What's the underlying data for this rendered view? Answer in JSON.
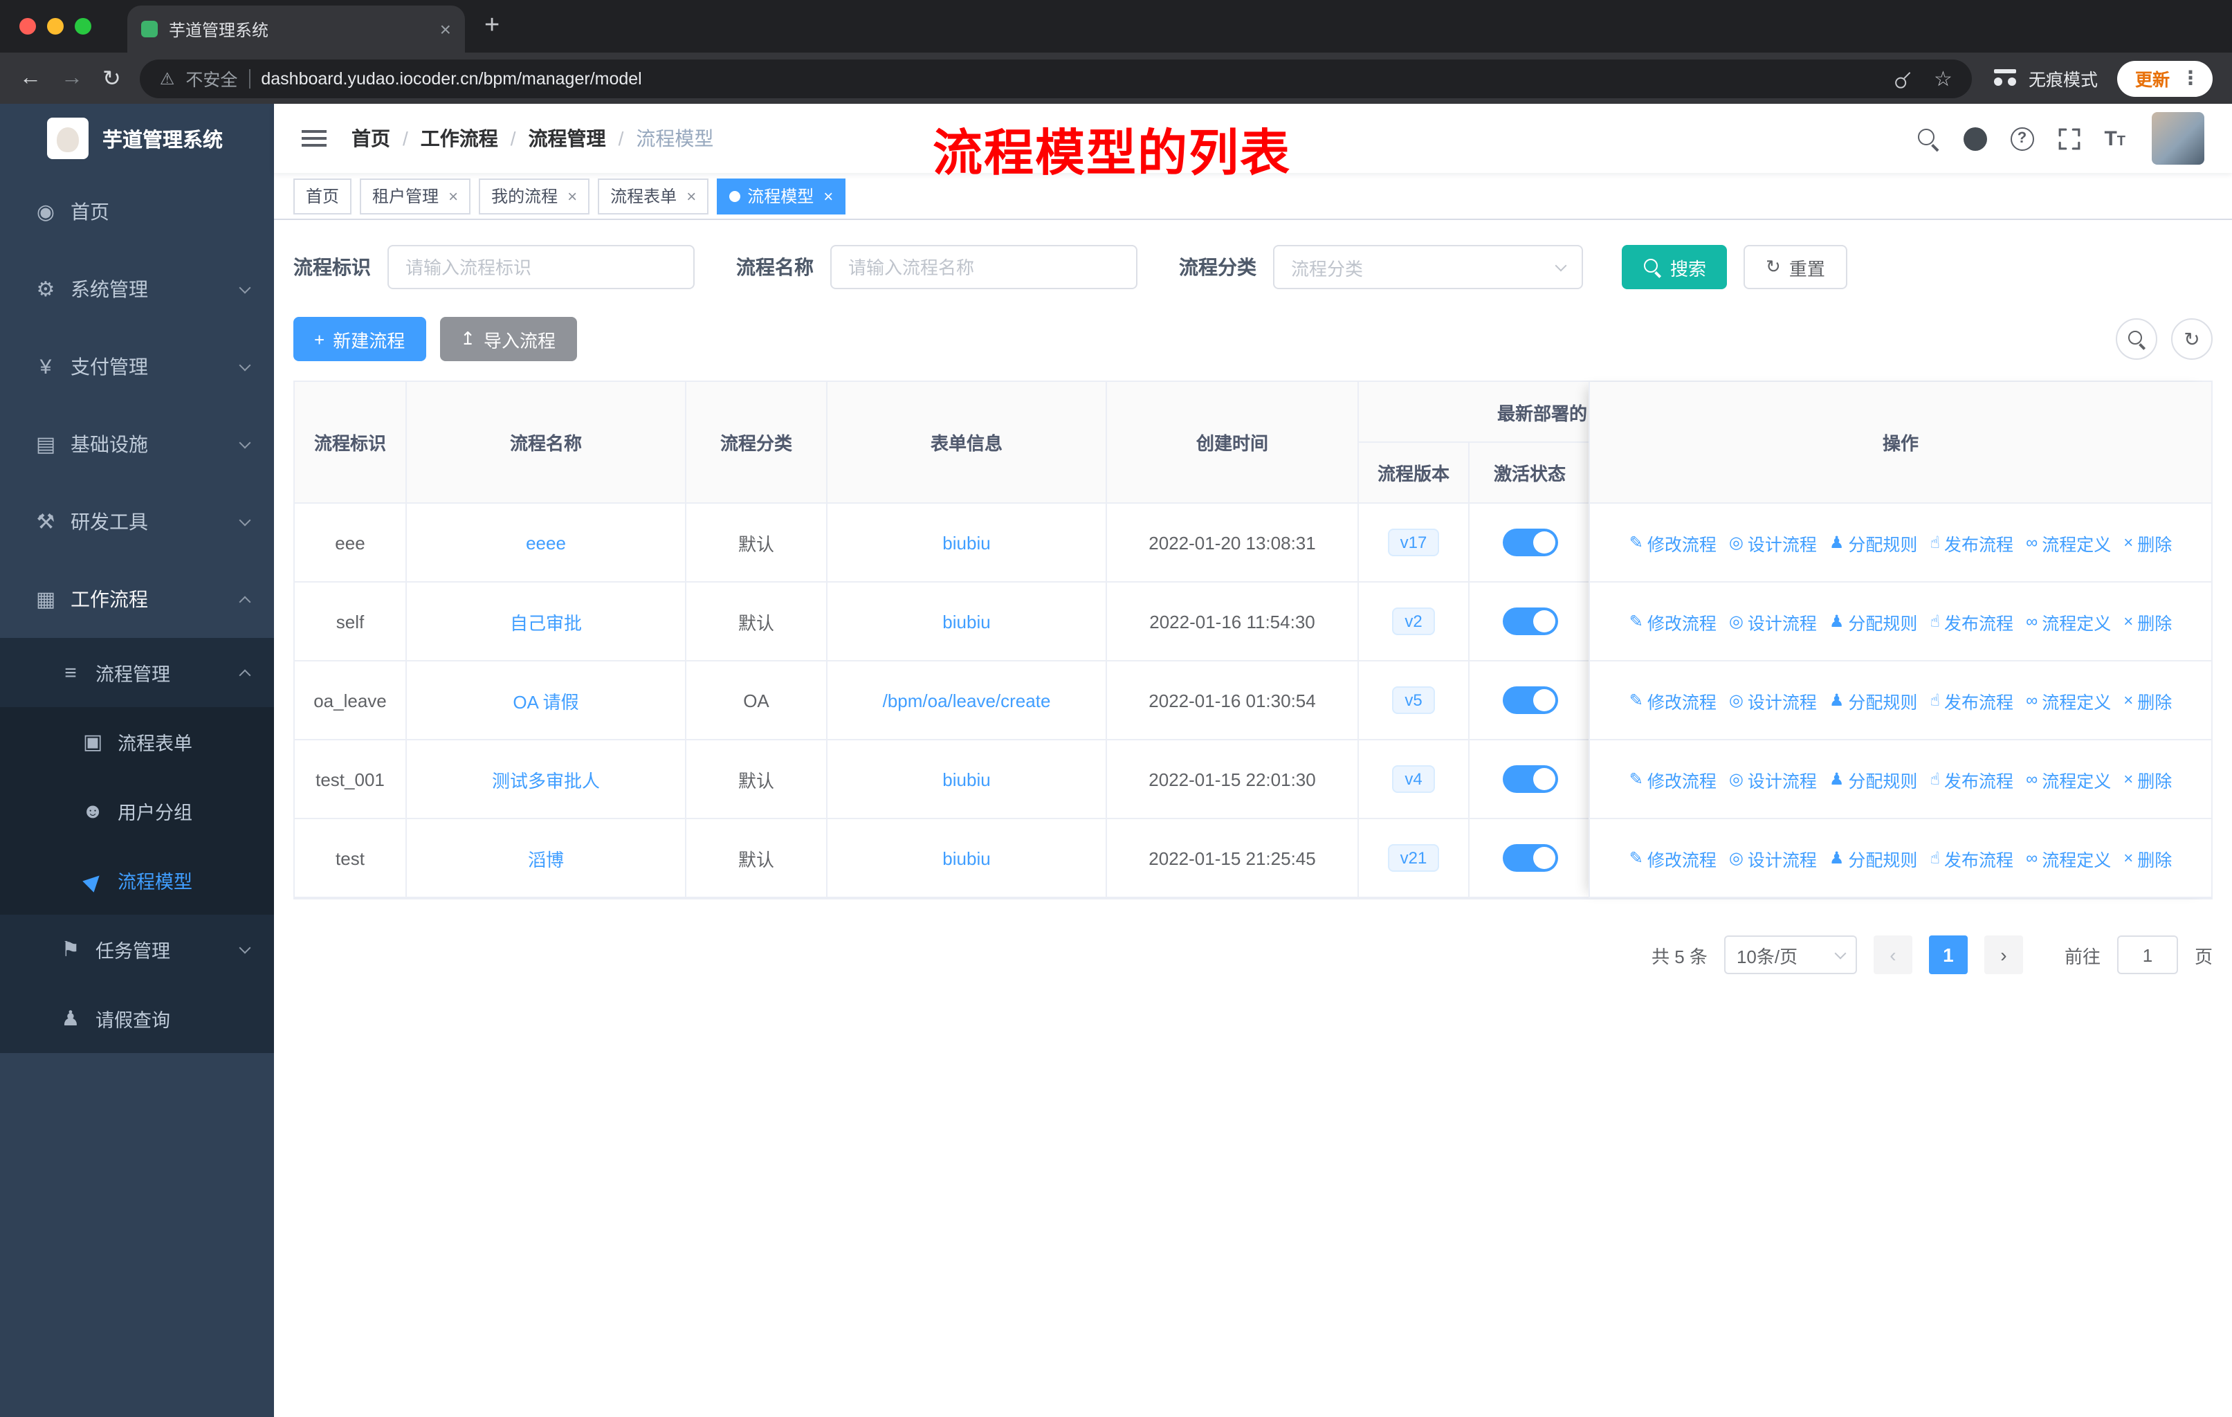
{
  "colors": {
    "primary": "#409eff",
    "search_button": "#14b8a6",
    "sidebar_bg": "#304156",
    "submenu_bg": "#1f2d3d",
    "annotation_red": "#fe0000"
  },
  "icons": {
    "close": "×",
    "new_tab": "+",
    "back": "←",
    "forward": "→",
    "reload": "↻",
    "warning": "⚠",
    "star": "☆",
    "dots": "⋮",
    "plus": "+",
    "upload": "↥",
    "refresh": "↻",
    "prev": "‹",
    "next": "›",
    "question": "?",
    "t_big": "T",
    "t_small": "T"
  },
  "browser": {
    "tab_title": "芋道管理系统",
    "security_label": "不安全",
    "url": "dashboard.yudao.iocoder.cn/bpm/manager/model",
    "incognito_label": "无痕模式",
    "update_label": "更新"
  },
  "sidebar": {
    "logo_title": "芋道管理系统",
    "menu": [
      {
        "label": "首页",
        "glyph": "◉"
      },
      {
        "label": "系统管理",
        "glyph": "⚙",
        "arrow": "down"
      },
      {
        "label": "支付管理",
        "glyph": "¥",
        "arrow": "down"
      },
      {
        "label": "基础设施",
        "glyph": "▤",
        "arrow": "down"
      },
      {
        "label": "研发工具",
        "glyph": "⚒",
        "arrow": "down"
      },
      {
        "label": "工作流程",
        "glyph": "▦",
        "arrow": "up"
      }
    ],
    "submenu": [
      {
        "label": "流程管理",
        "glyph": "≡",
        "arrow": "up"
      },
      {
        "label": "流程表单",
        "glyph": "▣"
      },
      {
        "label": "用户分组",
        "glyph": "☻"
      },
      {
        "label": "流程模型",
        "glyph": "▶"
      },
      {
        "label": "任务管理",
        "glyph": "⚑",
        "arrow": "down"
      },
      {
        "label": "请假查询",
        "glyph": "♟"
      }
    ]
  },
  "header": {
    "breadcrumb": [
      "首页",
      "工作流程",
      "流程管理",
      "流程模型"
    ],
    "separator": "/",
    "annotation": "流程模型的列表"
  },
  "tags": [
    {
      "label": "首页"
    },
    {
      "label": "租户管理"
    },
    {
      "label": "我的流程"
    },
    {
      "label": "流程表单"
    },
    {
      "label": "流程模型"
    }
  ],
  "filters": {
    "key_label": "流程标识",
    "key_placeholder": "请输入流程标识",
    "name_label": "流程名称",
    "name_placeholder": "请输入流程名称",
    "category_label": "流程分类",
    "category_placeholder": "流程分类",
    "search_label": "搜索",
    "reset_label": "重置"
  },
  "toolbar": {
    "create_label": "新建流程",
    "import_label": "导入流程"
  },
  "table": {
    "headers": {
      "key": "流程标识",
      "name": "流程名称",
      "category": "流程分类",
      "form": "表单信息",
      "created": "创建时间",
      "group": "最新部署的",
      "version": "流程版本",
      "active": "激活状态",
      "actions": "操作"
    },
    "rows": [
      {
        "key": "eee",
        "name": "eeee",
        "category": "默认",
        "form": "biubiu",
        "created": "2022-01-20 13:08:31",
        "version": "v17"
      },
      {
        "key": "self",
        "name": "自己审批",
        "category": "默认",
        "form": "biubiu",
        "created": "2022-01-16 11:54:30",
        "version": "v2"
      },
      {
        "key": "oa_leave",
        "name": "OA 请假",
        "category": "OA",
        "form": "/bpm/oa/leave/create",
        "created": "2022-01-16 01:30:54",
        "version": "v5"
      },
      {
        "key": "test_001",
        "name": "测试多审批人",
        "category": "默认",
        "form": "biubiu",
        "created": "2022-01-15 22:01:30",
        "version": "v4"
      },
      {
        "key": "test",
        "name": "滔博",
        "category": "默认",
        "form": "biubiu",
        "created": "2022-01-15 21:25:45",
        "version": "v21"
      }
    ],
    "row_actions": [
      {
        "label": "修改流程",
        "glyph": "✎"
      },
      {
        "label": "设计流程",
        "glyph": "◎"
      },
      {
        "label": "分配规则",
        "glyph": "♟"
      },
      {
        "label": "发布流程",
        "glyph": "☝"
      },
      {
        "label": "流程定义",
        "glyph": "∞"
      },
      {
        "label": "删除",
        "glyph": "×"
      }
    ]
  },
  "pagination": {
    "total": "共 5 条",
    "page_size": "10条/页",
    "current_page": "1",
    "goto_label": "前往",
    "goto_value": "1",
    "page_label": "页"
  }
}
